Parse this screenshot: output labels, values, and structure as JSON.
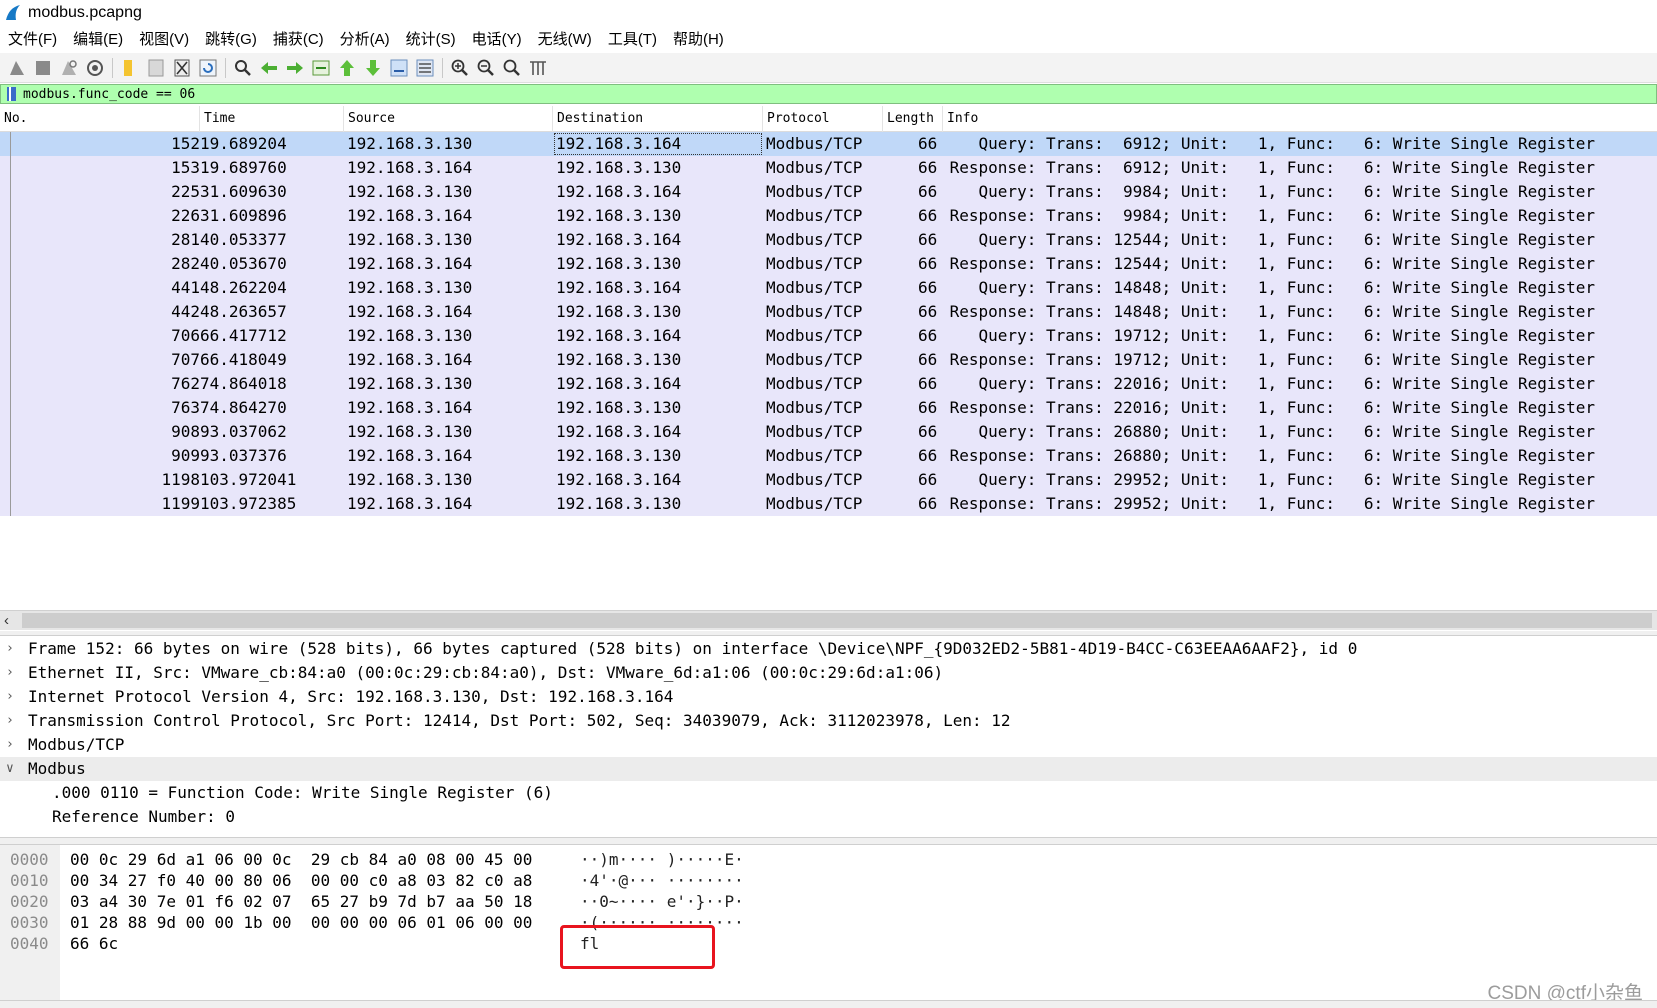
{
  "window": {
    "title": "modbus.pcapng"
  },
  "menu": [
    "文件(F)",
    "编辑(E)",
    "视图(V)",
    "跳转(G)",
    "捕获(C)",
    "分析(A)",
    "统计(S)",
    "电话(Y)",
    "无线(W)",
    "工具(T)",
    "帮助(H)"
  ],
  "toolbar": {
    "icons": [
      "start-capture-icon",
      "stop-capture-icon",
      "restart-capture-icon",
      "capture-options-icon",
      "open-file-icon",
      "save-file-icon",
      "close-file-icon",
      "reload-icon",
      "find-packet-icon",
      "go-back-icon",
      "go-forward-icon",
      "go-to-packet-icon",
      "first-packet-icon",
      "last-packet-icon",
      "autoscroll-icon",
      "colorize-icon",
      "zoom-in-icon",
      "zoom-out-icon",
      "zoom-normal-icon",
      "resize-columns-icon"
    ]
  },
  "filter": {
    "value": "modbus.func_code == 06"
  },
  "packet_list": {
    "columns": [
      "No.",
      "Time",
      "Source",
      "Destination",
      "Protocol",
      "Length",
      "Info"
    ],
    "rows": [
      {
        "no": "152",
        "time": "19.689204",
        "src": "192.168.3.130",
        "dst": "192.168.3.164",
        "proto": "Modbus/TCP",
        "len": "66",
        "info": "    Query: Trans:  6912; Unit:   1, Func:   6: Write Single Register"
      },
      {
        "no": "153",
        "time": "19.689760",
        "src": "192.168.3.164",
        "dst": "192.168.3.130",
        "proto": "Modbus/TCP",
        "len": "66",
        "info": " Response: Trans:  6912; Unit:   1, Func:   6: Write Single Register"
      },
      {
        "no": "225",
        "time": "31.609630",
        "src": "192.168.3.130",
        "dst": "192.168.3.164",
        "proto": "Modbus/TCP",
        "len": "66",
        "info": "    Query: Trans:  9984; Unit:   1, Func:   6: Write Single Register"
      },
      {
        "no": "226",
        "time": "31.609896",
        "src": "192.168.3.164",
        "dst": "192.168.3.130",
        "proto": "Modbus/TCP",
        "len": "66",
        "info": " Response: Trans:  9984; Unit:   1, Func:   6: Write Single Register"
      },
      {
        "no": "281",
        "time": "40.053377",
        "src": "192.168.3.130",
        "dst": "192.168.3.164",
        "proto": "Modbus/TCP",
        "len": "66",
        "info": "    Query: Trans: 12544; Unit:   1, Func:   6: Write Single Register"
      },
      {
        "no": "282",
        "time": "40.053670",
        "src": "192.168.3.164",
        "dst": "192.168.3.130",
        "proto": "Modbus/TCP",
        "len": "66",
        "info": " Response: Trans: 12544; Unit:   1, Func:   6: Write Single Register"
      },
      {
        "no": "441",
        "time": "48.262204",
        "src": "192.168.3.130",
        "dst": "192.168.3.164",
        "proto": "Modbus/TCP",
        "len": "66",
        "info": "    Query: Trans: 14848; Unit:   1, Func:   6: Write Single Register"
      },
      {
        "no": "442",
        "time": "48.263657",
        "src": "192.168.3.164",
        "dst": "192.168.3.130",
        "proto": "Modbus/TCP",
        "len": "66",
        "info": " Response: Trans: 14848; Unit:   1, Func:   6: Write Single Register"
      },
      {
        "no": "706",
        "time": "66.417712",
        "src": "192.168.3.130",
        "dst": "192.168.3.164",
        "proto": "Modbus/TCP",
        "len": "66",
        "info": "    Query: Trans: 19712; Unit:   1, Func:   6: Write Single Register"
      },
      {
        "no": "707",
        "time": "66.418049",
        "src": "192.168.3.164",
        "dst": "192.168.3.130",
        "proto": "Modbus/TCP",
        "len": "66",
        "info": " Response: Trans: 19712; Unit:   1, Func:   6: Write Single Register"
      },
      {
        "no": "762",
        "time": "74.864018",
        "src": "192.168.3.130",
        "dst": "192.168.3.164",
        "proto": "Modbus/TCP",
        "len": "66",
        "info": "    Query: Trans: 22016; Unit:   1, Func:   6: Write Single Register"
      },
      {
        "no": "763",
        "time": "74.864270",
        "src": "192.168.3.164",
        "dst": "192.168.3.130",
        "proto": "Modbus/TCP",
        "len": "66",
        "info": " Response: Trans: 22016; Unit:   1, Func:   6: Write Single Register"
      },
      {
        "no": "908",
        "time": "93.037062",
        "src": "192.168.3.130",
        "dst": "192.168.3.164",
        "proto": "Modbus/TCP",
        "len": "66",
        "info": "    Query: Trans: 26880; Unit:   1, Func:   6: Write Single Register"
      },
      {
        "no": "909",
        "time": "93.037376",
        "src": "192.168.3.164",
        "dst": "192.168.3.130",
        "proto": "Modbus/TCP",
        "len": "66",
        "info": " Response: Trans: 26880; Unit:   1, Func:   6: Write Single Register"
      },
      {
        "no": "1198",
        "time": "103.972041",
        "src": "192.168.3.130",
        "dst": "192.168.3.164",
        "proto": "Modbus/TCP",
        "len": "66",
        "info": "    Query: Trans: 29952; Unit:   1, Func:   6: Write Single Register"
      },
      {
        "no": "1199",
        "time": "103.972385",
        "src": "192.168.3.164",
        "dst": "192.168.3.130",
        "proto": "Modbus/TCP",
        "len": "66",
        "info": " Response: Trans: 29952; Unit:   1, Func:   6: Write Single Register"
      }
    ]
  },
  "details": [
    {
      "text": "Frame 152: 66 bytes on wire (528 bits), 66 bytes captured (528 bits) on interface \\Device\\NPF_{9D032ED2-5B81-4D19-B4CC-C63EEAA6AAF2}, id 0",
      "expanded": false
    },
    {
      "text": "Ethernet II, Src: VMware_cb:84:a0 (00:0c:29:cb:84:a0), Dst: VMware_6d:a1:06 (00:0c:29:6d:a1:06)",
      "expanded": false
    },
    {
      "text": "Internet Protocol Version 4, Src: 192.168.3.130, Dst: 192.168.3.164",
      "expanded": false
    },
    {
      "text": "Transmission Control Protocol, Src Port: 12414, Dst Port: 502, Seq: 34039079, Ack: 3112023978, Len: 12",
      "expanded": false
    },
    {
      "text": "Modbus/TCP",
      "expanded": false
    },
    {
      "text": "Modbus",
      "expanded": true
    },
    {
      "text": ".000 0110 = Function Code: Write Single Register (6)",
      "child": true
    },
    {
      "text": "Reference Number: 0",
      "child": true
    }
  ],
  "bytes": [
    {
      "offset": "0000",
      "hex": "00 0c 29 6d a1 06 00 0c  29 cb 84 a0 08 00 45 00",
      "ascii": "··)m···· )·····E·"
    },
    {
      "offset": "0010",
      "hex": "00 34 27 f0 40 00 80 06  00 00 c0 a8 03 82 c0 a8",
      "ascii": "·4'·@··· ········"
    },
    {
      "offset": "0020",
      "hex": "03 a4 30 7e 01 f6 02 07  65 27 b9 7d b7 aa 50 18",
      "ascii": "··0~···· e'·}··P·"
    },
    {
      "offset": "0030",
      "hex": "01 28 88 9d 00 00 1b 00  00 00 00 06 01 06 00 00",
      "ascii": "·(······ ········"
    },
    {
      "offset": "0040",
      "hex": "66 6c",
      "ascii": "fl"
    }
  ],
  "watermark": "CSDN @ctf小杂鱼",
  "colors": {
    "filter_bg": "#afffaf",
    "row_bg": "#e8e6fa",
    "selected_row_bg": "#c0d8f8",
    "annotation_red": "#e8141e"
  }
}
